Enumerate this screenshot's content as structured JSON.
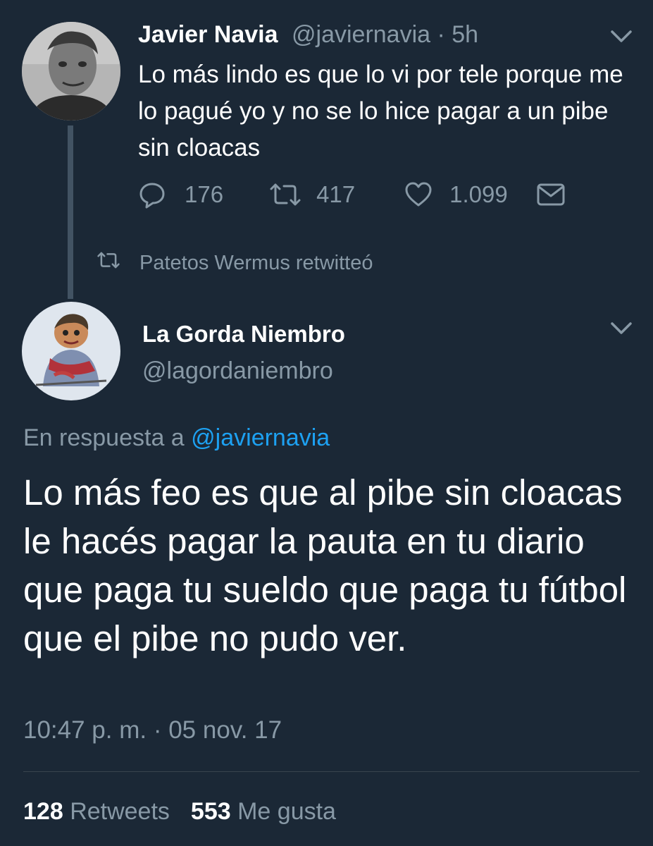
{
  "tweet1": {
    "author_name": "Javier Navia",
    "author_handle": "@javiernavia · 5h",
    "text": "Lo más lindo es que lo vi por tele porque me lo pagué yo y no se lo hice pagar a un pibe sin cloacas",
    "replies": "176",
    "retweets": "417",
    "likes": "1.099"
  },
  "retweet_context": {
    "label": "Patetos Wermus retwitteó"
  },
  "tweet2": {
    "author_name": "La Gorda Niembro",
    "author_handle": "@lagordaniembro",
    "reply_prefix": "En respuesta a",
    "reply_mention": "@javiernavia",
    "text": "Lo más feo es que al pibe sin cloacas le hacés pagar la pauta en tu diario que paga tu sueldo que paga tu fútbol que el pibe no pudo ver.",
    "timestamp": "10:47 p. m. · 05 nov. 17",
    "retweet_count": "128",
    "retweet_label": "Retweets",
    "like_count": "553",
    "like_label": "Me gusta"
  },
  "colors": {
    "background": "#1b2836",
    "muted": "#8899a6",
    "link": "#1da1f2"
  },
  "icons": [
    "reply-icon",
    "retweet-icon",
    "like-icon",
    "dm-icon",
    "chevron-down-icon"
  ]
}
